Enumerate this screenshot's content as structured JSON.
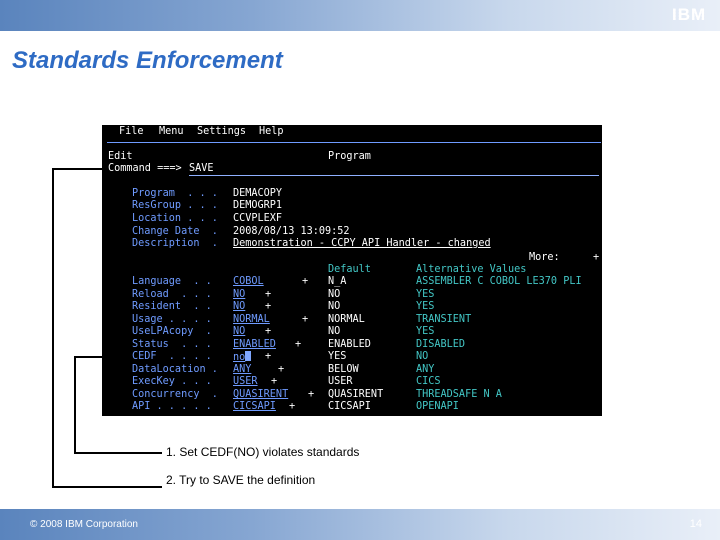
{
  "header": {
    "logo": "IBM"
  },
  "slide": {
    "title": "Standards Enforcement"
  },
  "terminal": {
    "menu": [
      "File",
      "Menu",
      "Settings",
      "Help"
    ],
    "mode": "Edit",
    "section": "Program",
    "command_label": "Command ===>",
    "command_value": "SAVE",
    "info": [
      {
        "label": "Program  . . .",
        "value": "DEMACOPY"
      },
      {
        "label": "ResGroup . . .",
        "value": "DEMOGRP1"
      },
      {
        "label": "Location . . .",
        "value": "CCVPLEXF"
      },
      {
        "label": "Change Date  .",
        "value": "2008/08/13 13:09:52"
      },
      {
        "label": "Description  .",
        "value": "Demonstration - CCPY API Handler - changed"
      }
    ],
    "more": "More:",
    "more_sign": "+",
    "col_default": "Default",
    "col_alternative": "Alternative Values",
    "attributes": [
      {
        "label": "Language  . .",
        "value": "COBOL",
        "plus": "+",
        "default": "N_A",
        "alt": "ASSEMBLER C COBOL LE370 PLI"
      },
      {
        "label": "Reload  . . .",
        "value": "NO",
        "plus": "+",
        "default": "NO",
        "alt": "YES"
      },
      {
        "label": "Resident  . .",
        "value": "NO",
        "plus": "+",
        "default": "NO",
        "alt": "YES"
      },
      {
        "label": "Usage . . . .",
        "value": "NORMAL",
        "plus": "+",
        "default": "NORMAL",
        "alt": "TRANSIENT"
      },
      {
        "label": "UseLPAcopy  .",
        "value": "NO",
        "plus": "+",
        "default": "NO",
        "alt": "YES"
      },
      {
        "label": "Status  . . .",
        "value": "ENABLED",
        "plus": "+",
        "default": "ENABLED",
        "alt": "DISABLED"
      },
      {
        "label": "CEDF  . . . .",
        "value": "no",
        "plus": "+",
        "default": "YES",
        "alt": "NO"
      },
      {
        "label": "DataLocation .",
        "value": "ANY",
        "plus": "+",
        "default": "BELOW",
        "alt": "ANY"
      },
      {
        "label": "ExecKey . . .",
        "value": "USER",
        "plus": "+",
        "default": "USER",
        "alt": "CICS"
      },
      {
        "label": "Concurrency  .",
        "value": "QUASIRENT",
        "plus": "+",
        "default": "QUASIRENT",
        "alt": "THREADSAFE N A"
      },
      {
        "label": "API . . . . .",
        "value": "CICSAPI",
        "plus": "+",
        "default": "CICSAPI",
        "alt": "OPENAPI"
      }
    ]
  },
  "notes": [
    "1.  Set CEDF(NO) violates standards",
    "2.  Try to SAVE the definition"
  ],
  "footer": {
    "copyright": "© 2008 IBM Corporation",
    "page": "14"
  }
}
